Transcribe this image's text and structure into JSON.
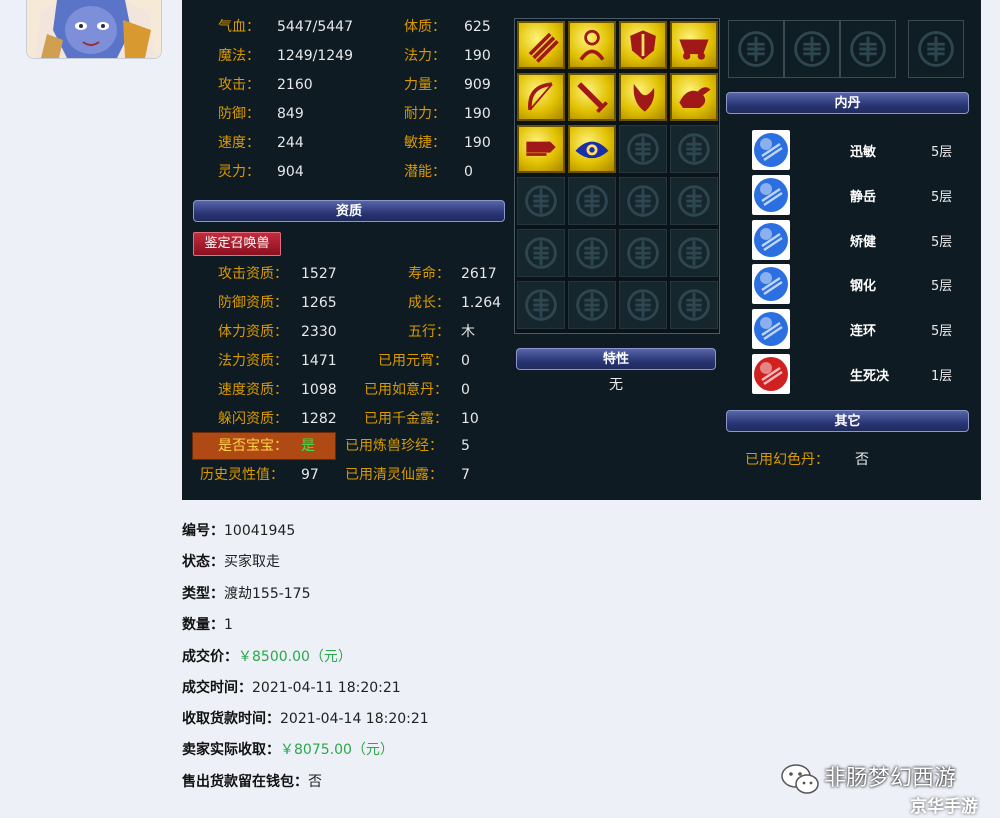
{
  "stats": [
    {
      "label": "气血：",
      "value": "5447/5447",
      "label2": "体质：",
      "value2": "625"
    },
    {
      "label": "魔法：",
      "value": "1249/1249",
      "label2": "法力：",
      "value2": "190"
    },
    {
      "label": "攻击：",
      "value": "2160",
      "label2": "力量：",
      "value2": "909"
    },
    {
      "label": "防御：",
      "value": "849",
      "label2": "耐力：",
      "value2": "190"
    },
    {
      "label": "速度：",
      "value": "244",
      "label2": "敏捷：",
      "value2": "190"
    },
    {
      "label": "灵力：",
      "value": "904",
      "label2": "潜能：",
      "value2": "0"
    }
  ],
  "zizhi_title": "资质",
  "identify_button": "鉴定召唤兽",
  "aptitudes": [
    {
      "label": "攻击资质：",
      "value": "1527",
      "label2": "寿命：",
      "value2": "2617"
    },
    {
      "label": "防御资质：",
      "value": "1265",
      "label2": "成长：",
      "value2": "1.264"
    },
    {
      "label": "体力资质：",
      "value": "2330",
      "label2": "五行：",
      "value2": "木"
    },
    {
      "label": "法力资质：",
      "value": "1471",
      "label2": "已用元宵：",
      "value2": "0"
    },
    {
      "label": "速度资质：",
      "value": "1098",
      "label2": "已用如意丹：",
      "value2": "0"
    },
    {
      "label": "躲闪资质：",
      "value": "1282",
      "label2": "已用千金露：",
      "value2": "10"
    },
    {
      "label": "是否宝宝：",
      "value": "是",
      "label2": "已用炼兽珍经：",
      "value2": "5"
    },
    {
      "label": "历史灵性值：",
      "value": "97",
      "label2": "已用清灵仙露：",
      "value2": "7"
    }
  ],
  "traits_title": "特性",
  "traits_value": "无",
  "neidan_title": "内丹",
  "neidan": [
    {
      "name": "迅敏",
      "level": "5层",
      "color": "#2b6fe0"
    },
    {
      "name": "静岳",
      "level": "5层",
      "color": "#2b6fe0"
    },
    {
      "name": "矫健",
      "level": "5层",
      "color": "#2b6fe0"
    },
    {
      "name": "钢化",
      "level": "5层",
      "color": "#2b6fe0"
    },
    {
      "name": "连环",
      "level": "5层",
      "color": "#2b6fe0"
    },
    {
      "name": "生死决",
      "level": "1层",
      "color": "#d02020"
    }
  ],
  "other_title": "其它",
  "other_label": "已用幻色丹：",
  "other_value": "否",
  "skill_icons": [
    "claw-skill",
    "figure-skill",
    "shield-skill",
    "chariot-skill",
    "bow-skill",
    "sword-skill",
    "fang-skill",
    "beast-skill",
    "scroll-skill",
    "eye-skill"
  ],
  "info": {
    "id_label": "编号：",
    "id_value": "10041945",
    "status_label": "状态：",
    "status_value": "买家取走",
    "type_label": "类型：",
    "type_value": "渡劫155-175",
    "qty_label": "数量：",
    "qty_value": "1",
    "price_label": "成交价：",
    "price_value": "￥8500.00（元）",
    "deal_time_label": "成交时间：",
    "deal_time_value": "2021-04-11 18:20:21",
    "pay_time_label": "收取货款时间：",
    "pay_time_value": "2021-04-14 18:20:21",
    "seller_label": "卖家实际收取：",
    "seller_value": "￥8075.00（元）",
    "wallet_label": "售出货款留在钱包：",
    "wallet_value": "否"
  },
  "watermark": {
    "line1": "非肠梦幻西游",
    "line2": "京华手游"
  },
  "colors": {
    "panel": "#0e1b22",
    "label_orange": "#d99a00",
    "price_green": "#2aa84a",
    "bar_blue": "#2a3676"
  }
}
